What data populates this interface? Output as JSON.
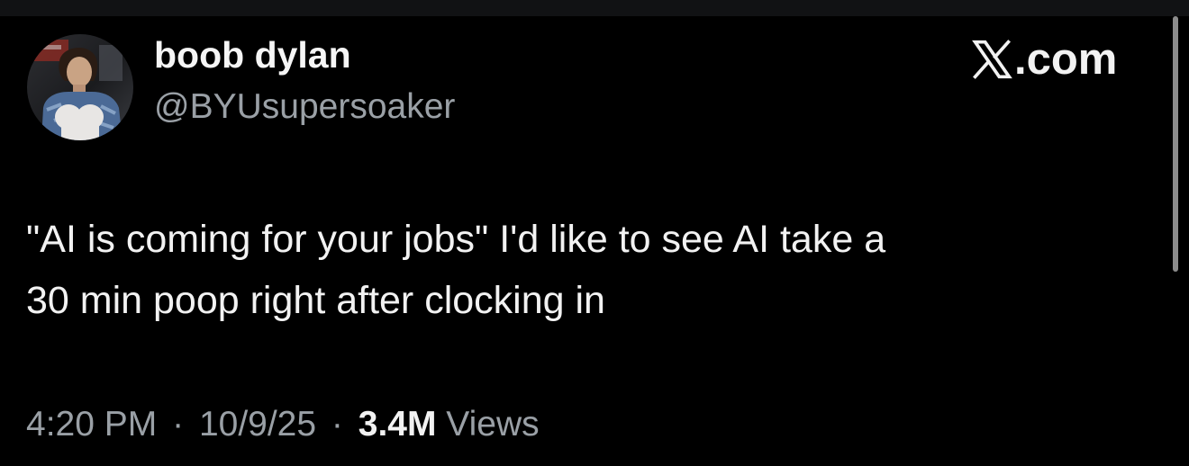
{
  "header": {
    "display_name": "boob dylan",
    "handle": "@BYUsupersoaker",
    "brand": {
      "icon": "x-logo-icon",
      "text": ".com"
    }
  },
  "tweet": {
    "lines": [
      "\"AI is coming for your jobs\" I'd like to see AI take a",
      "30 min poop right after clocking in"
    ]
  },
  "meta": {
    "time": "4:20 PM",
    "separator": "·",
    "date": "10/9/25",
    "views_count": "3.4M",
    "views_label": "Views"
  },
  "colors": {
    "background": "#000000",
    "text_primary": "#f2f2f2",
    "text_secondary": "#9aa0a6",
    "scrollbar": "#8c8c8c"
  }
}
